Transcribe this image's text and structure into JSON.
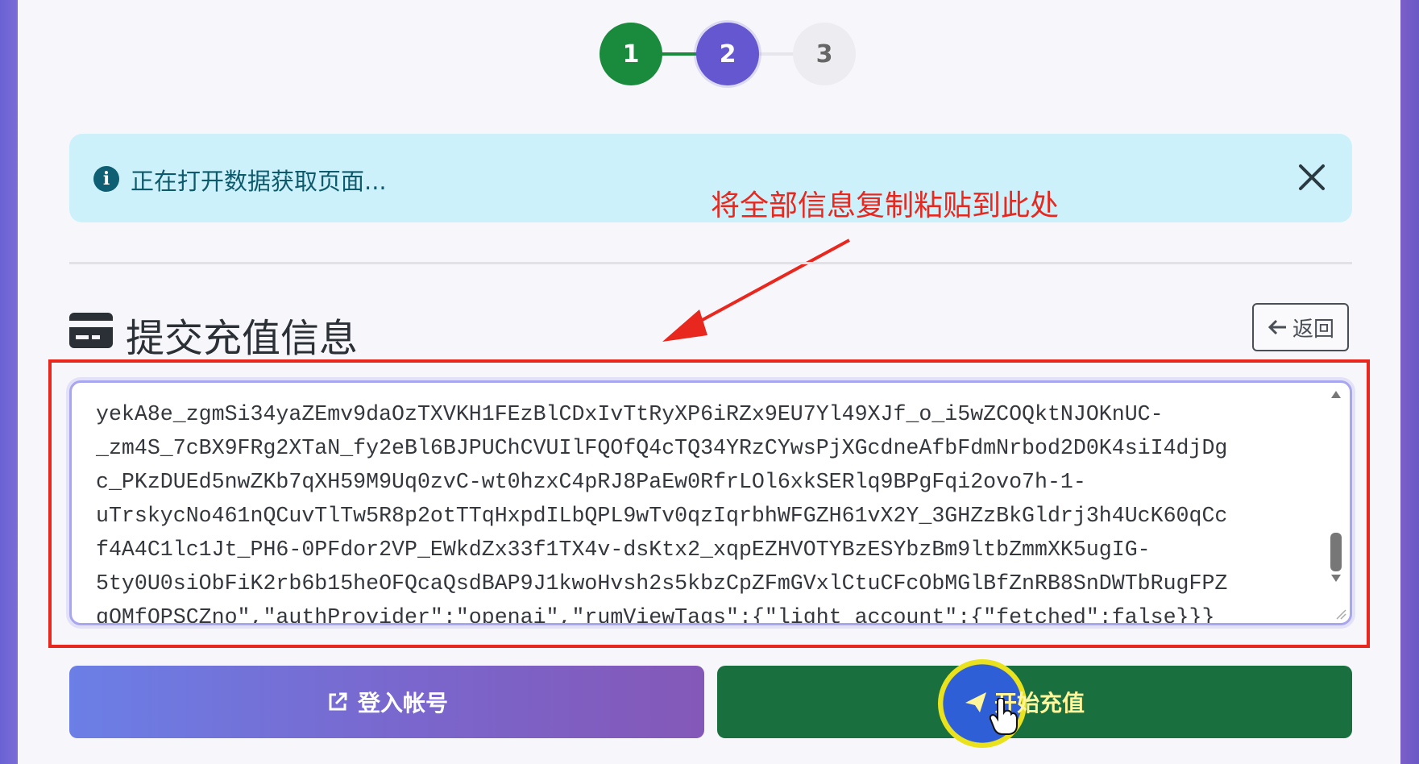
{
  "stepper": {
    "steps": [
      "1",
      "2",
      "3"
    ],
    "active_step": 2,
    "colors": {
      "done": "#1a8a3c",
      "active": "#6457cf",
      "pending": "#ededf1"
    }
  },
  "alert": {
    "icon": "info-icon",
    "text": "正在打开数据获取页面...",
    "close_icon": "close-icon"
  },
  "annotation": {
    "text": "将全部信息复制粘贴到此处",
    "color": "#e8281f"
  },
  "section": {
    "icon": "credit-card-icon",
    "title": "提交充值信息",
    "back_label": "返回"
  },
  "payload": {
    "lines": [
      "yekA8e_zgmSi34yaZEmv9daOzTXVKH1FEzBlCDxIvTtRyXP6iRZx9EU7Yl49XJf_o_i5wZCOQktNJOKnUC-",
      "_zm4S_7cBX9FRg2XTaN_fy2eBl6BJPUChCVUIlFQOfQ4cTQ34YRzCYwsPjXGcdneAfbFdmNrbod2D0K4siI4djDg",
      "c_PKzDUEd5nwZKb7qXH59M9Uq0zvC-wt0hzxC4pRJ8PaEw0RfrLOl6xkSERlq9BPgFqi2ovo7h-1-",
      "uTrskycNo461nQCuvTlTw5R8p2otTTqHxpdILbQPL9wTv0qzIqrbhWFGZH61vX2Y_3GHZzBkGldrj3h4UcK60qCc",
      "f4A4C1lc1Jt_PH6-0PFdor2VP_EWkdZx33f1TX4v-dsKtx2_xqpEZHVOTYBzESYbzBm9ltbZmmXK5ugIG-",
      "5ty0U0siObFiK2rb6b15heOFQcaQsdBAP9J1kwoHvsh2s5kbzCpZFmGVxlCtuCFcObMGlBfZnRB8SnDWTbRugFPZ",
      "qOMfOPSCZno\",\"authProvider\":\"openai\",\"rumViewTags\":{\"light_account\":{\"fetched\":false}}}"
    ]
  },
  "buttons": {
    "login_label": "登入帐号",
    "login_icon": "external-link-icon",
    "start_label": "开始充值",
    "start_icon": "send-icon"
  }
}
